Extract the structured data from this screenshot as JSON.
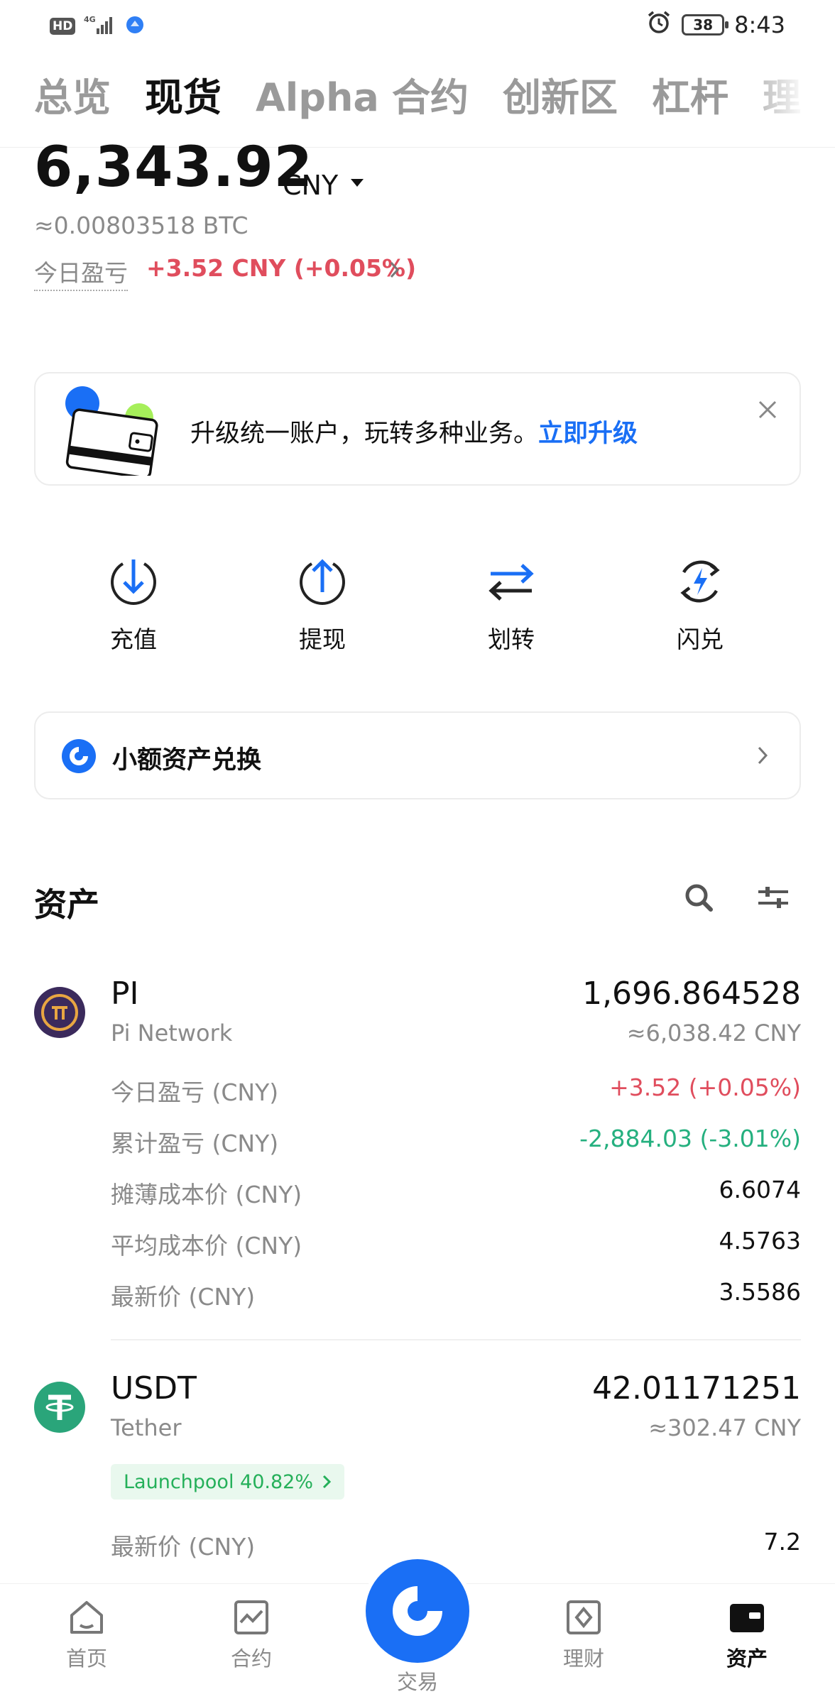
{
  "status_bar": {
    "hd": "HD",
    "network": "4G",
    "battery": "38",
    "time": "8:43"
  },
  "tabs": [
    "总览",
    "现货",
    "Alpha",
    "合约",
    "创新区",
    "杠杆",
    "理"
  ],
  "active_tab": "现货",
  "balance": {
    "amount": "6,343.92",
    "currency": "CNY",
    "btc": "≈0.00803518 BTC",
    "today_pnl_label": "今日盈亏",
    "today_pnl_value": "+3.52 CNY (+0.05%)"
  },
  "banner": {
    "text": "升级统一账户，玩转多种业务。",
    "link": "立即升级"
  },
  "actions": [
    {
      "label": "充值",
      "icon": "deposit-icon"
    },
    {
      "label": "提现",
      "icon": "withdraw-icon"
    },
    {
      "label": "划转",
      "icon": "transfer-icon"
    },
    {
      "label": "闪兑",
      "icon": "flash-swap-icon"
    }
  ],
  "small_exchange": {
    "label": "小额资产兑换"
  },
  "assets": {
    "title": "资产",
    "items": [
      {
        "symbol": "PI",
        "name": "Pi Network",
        "amount": "1,696.864528",
        "cny": "≈6,038.42 CNY",
        "rows": [
          {
            "label": "今日盈亏 (CNY)",
            "value": "+3.52 (+0.05%)",
            "tone": "red"
          },
          {
            "label": "累计盈亏 (CNY)",
            "value": "-2,884.03 (-3.01%)",
            "tone": "green"
          },
          {
            "label": "摊薄成本价 (CNY)",
            "value": "6.6074",
            "tone": "normal"
          },
          {
            "label": "平均成本价 (CNY)",
            "value": "4.5763",
            "tone": "normal"
          },
          {
            "label": "最新价 (CNY)",
            "value": "3.5586",
            "tone": "normal"
          }
        ]
      },
      {
        "symbol": "USDT",
        "name": "Tether",
        "amount": "42.01171251",
        "cny": "≈302.47 CNY",
        "launchpool": "Launchpool 40.82%",
        "rows": [
          {
            "label": "最新价 (CNY)",
            "value": "7.2",
            "tone": "normal"
          }
        ]
      }
    ]
  },
  "bottom_nav": [
    {
      "label": "首页",
      "icon": "home-icon"
    },
    {
      "label": "合约",
      "icon": "futures-icon"
    },
    {
      "label": "交易",
      "icon": "trade-icon"
    },
    {
      "label": "理财",
      "icon": "earn-icon"
    },
    {
      "label": "资产",
      "icon": "wallet-icon"
    }
  ],
  "colors": {
    "accent": "#1a6ff5",
    "up": "#e04d5d",
    "down": "#25b07f",
    "pi": "#3b2a5c",
    "tether": "#2aa57a"
  }
}
